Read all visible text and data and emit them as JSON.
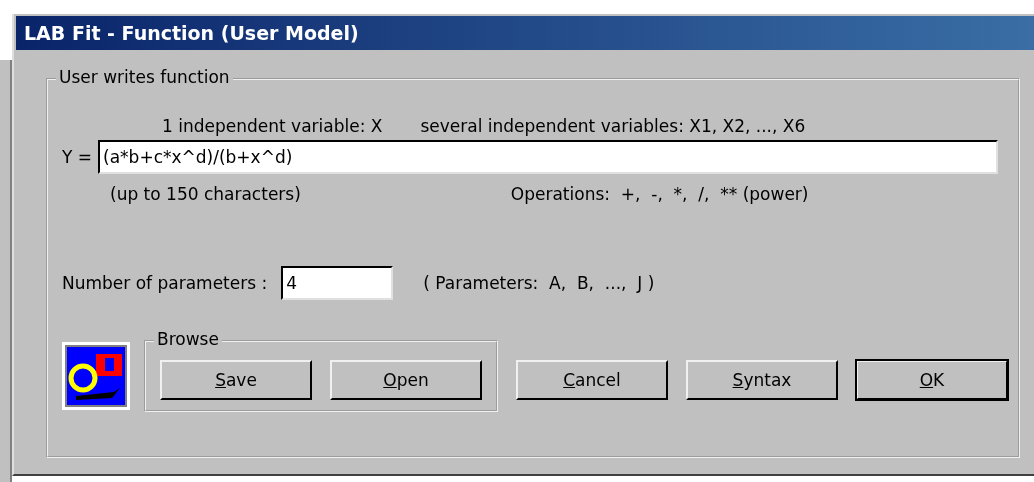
{
  "window": {
    "title": "LAB Fit - Function (User Model)"
  },
  "group": {
    "title": "User writes function"
  },
  "hint_single": "1 independent variable: X",
  "hint_several": "several independent variables: X1, X2, ..., X6",
  "function_label": "Y =",
  "function_value": "(a*b+c*x^d)/(b+x^d)",
  "length_note": "(up to 150 characters)",
  "operations_note": "Operations:  +,  -,  *,  /,  ** (power)",
  "parameters": {
    "label": "Number of parameters :",
    "value": "4",
    "note": "( Parameters:  A,  B,  ...,  J )"
  },
  "browse": {
    "title": "Browse",
    "buttons": [
      {
        "label": "Save",
        "default": false
      },
      {
        "label": "Open",
        "default": false
      }
    ]
  },
  "buttons": [
    {
      "label": "Cancel",
      "default": false
    },
    {
      "label": "Syntax",
      "default": false
    },
    {
      "label": "OK",
      "default": true
    }
  ]
}
